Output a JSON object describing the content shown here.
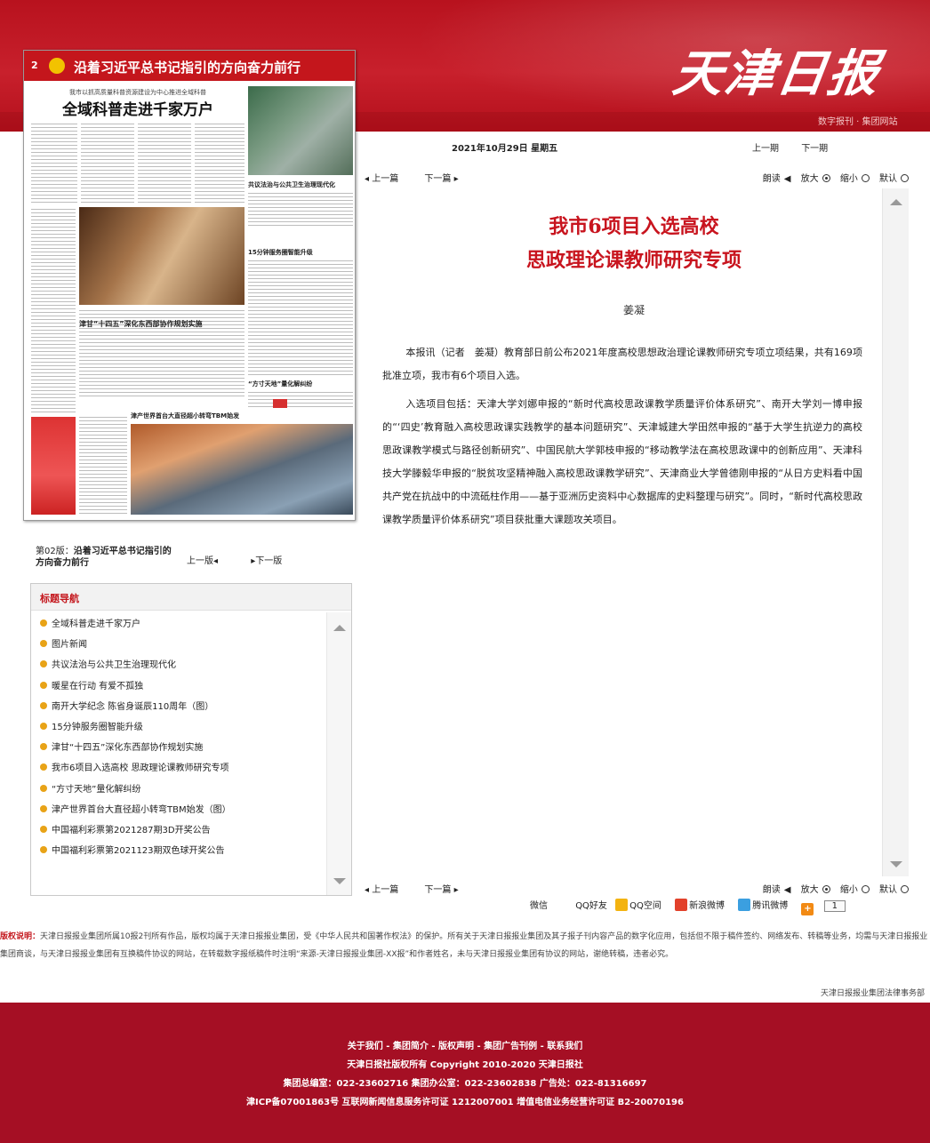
{
  "masthead": "天津日报",
  "header_links": "数字报刊 · 集团网站",
  "thumbnail": {
    "page_no": "2",
    "banner_title": "沿着习近平总书记指引的方向奋力前行",
    "lead": "我市以抓高质量科普资源建设为中心推进全域科普",
    "headline": "全域科普走进千家万户",
    "side_head_1": "共议法治与公共卫生治理现代化",
    "side_head_2": "15分钟服务圈智能升级",
    "mid_head": "津甘“十四五”深化东西部协作规划实施",
    "side_head_3": "“方寸天地”量化解纠纷",
    "lower_head": "津产世界首台大直径超小转弯TBM始发"
  },
  "date_line": "2021年10月29日  星期五",
  "issue_nav": {
    "prev": "上一期",
    "next": "下一期"
  },
  "toolbar": {
    "prev_page": "◂  上一篇",
    "next_page": "下一篇  ▸",
    "read": "朗读",
    "zoom_in": "放大",
    "zoom_out": "缩小",
    "default": "默认"
  },
  "article": {
    "title_line1": "我市6项目入选高校",
    "title_line2": "思政理论课教师研究专项",
    "author": "姜凝",
    "paragraph1": "本报讯（记者　姜凝）教育部日前公布2021年度高校思想政治理论课教师研究专项立项结果，共有169项批准立项，我市有6个项目入选。",
    "paragraph2": "入选项目包括：天津大学刘娜申报的“新时代高校思政课教学质量评价体系研究”、南开大学刘一博申报的“‘四史’教育融入高校思政课实践教学的基本问题研究”、天津城建大学田然申报的“基于大学生抗逆力的高校思政课教学模式与路径创新研究”、中国民航大学郭枝申报的“移动教学法在高校思政课中的创新应用”、天津科技大学滕毅华申报的“脱贫攻坚精神融入高校思政课教学研究”、天津商业大学曾德刚申报的“从日方史料看中国共产党在抗战中的中流砥柱作用——基于亚洲历史资料中心数据库的史料整理与研究”。同时，“新时代高校思政课教学质量评价体系研究”项目获批重大课题攻关项目。"
  },
  "share": {
    "wechat": "微信",
    "qq_friend": "QQ好友",
    "qq_zone": "QQ空间",
    "weibo": "新浪微博",
    "tencent_weibo": "腾讯微博",
    "count": "1"
  },
  "edition": {
    "prefix": "第02版：",
    "name": "沿着习近平总书记指引的方向奋力前行",
    "prev": "上一版◂",
    "next": "▸下一版"
  },
  "toc": {
    "heading": "标题导航",
    "items": [
      "全域科普走进千家万户",
      "图片新闻",
      "共议法治与公共卫生治理现代化",
      "暖星在行动 有爱不孤独",
      "南开大学纪念 陈省身诞辰110周年（图）",
      "15分钟服务圈智能升级",
      "津甘“十四五”深化东西部协作规划实施",
      "我市6项目入选高校 思政理论课教师研究专项",
      "“方寸天地”量化解纠纷",
      "津产世界首台大直径超小转弯TBM始发（图）",
      "中国福利彩票第2021287期3D开奖公告",
      "中国福利彩票第2021123期双色球开奖公告"
    ]
  },
  "copyright": {
    "label": "版权说明：",
    "text": "天津日报报业集团所属10报2刊所有作品，版权均属于天津日报报业集团，受《中华人民共和国著作权法》的保护。所有关于天津日报报业集团及其子报子刊内容产品的数字化应用，包括但不限于稿件签约、网络发布、转稿等业务，均需与天津日报报业集团商谈，与天津日报报业集团有互换稿件协议的网站，在转载数字报纸稿件时注明“来源-天津日报报业集团-XX报”和作者姓名，未与天津日报报业集团有协议的网站，谢绝转稿，违者必究。",
    "legal": "天津日报报业集团法律事务部"
  },
  "footer": {
    "links": "关于我们 - 集团简介 - 版权声明 - 集团广告刊例 - 联系我们",
    "rights": "天津日报社版权所有 Copyright 2010-2020 天津日报社",
    "phones": "集团总编室：022-23602716  集团办公室：022-23602838  广告处：022-81316697",
    "license": "津ICP备07001863号  互联网新闻信息服务许可证 1212007001  增值电信业务经营许可证 B2-20070196"
  },
  "colors": {
    "brand_red": "#c4161c",
    "footer_red": "#a50f24",
    "bullet": "#e8a317"
  }
}
